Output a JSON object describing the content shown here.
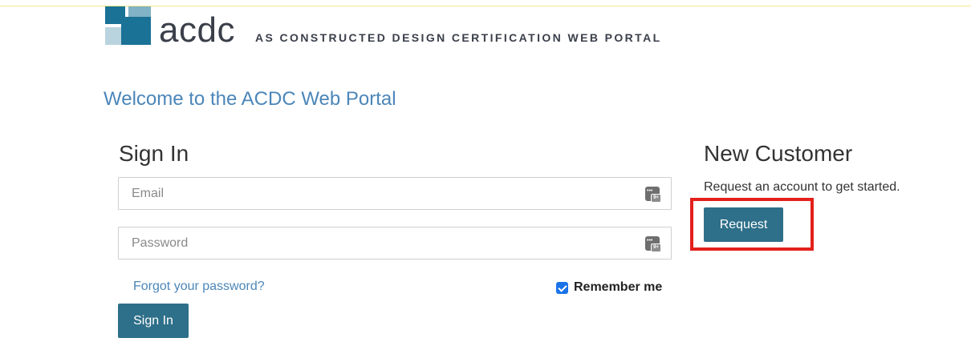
{
  "header": {
    "logo_word": "acdc",
    "tagline": "AS CONSTRUCTED DESIGN CERTIFICATION WEB PORTAL",
    "brand_color": "#1a7296"
  },
  "welcome": "Welcome to the ACDC Web Portal",
  "signin": {
    "title": "Sign In",
    "email_placeholder": "Email",
    "password_placeholder": "Password",
    "field_icon": "password-manager-icon",
    "forgot_link": "Forgot your password?",
    "remember_label": "Remember me",
    "remember_checked": true,
    "button_label": "Sign In"
  },
  "new_customer": {
    "title": "New Customer",
    "text": "Request an account to get started.",
    "button_label": "Request",
    "highlight_color": "#e3201b"
  },
  "colors": {
    "button": "#2e6f89",
    "link": "#4b86b9"
  }
}
